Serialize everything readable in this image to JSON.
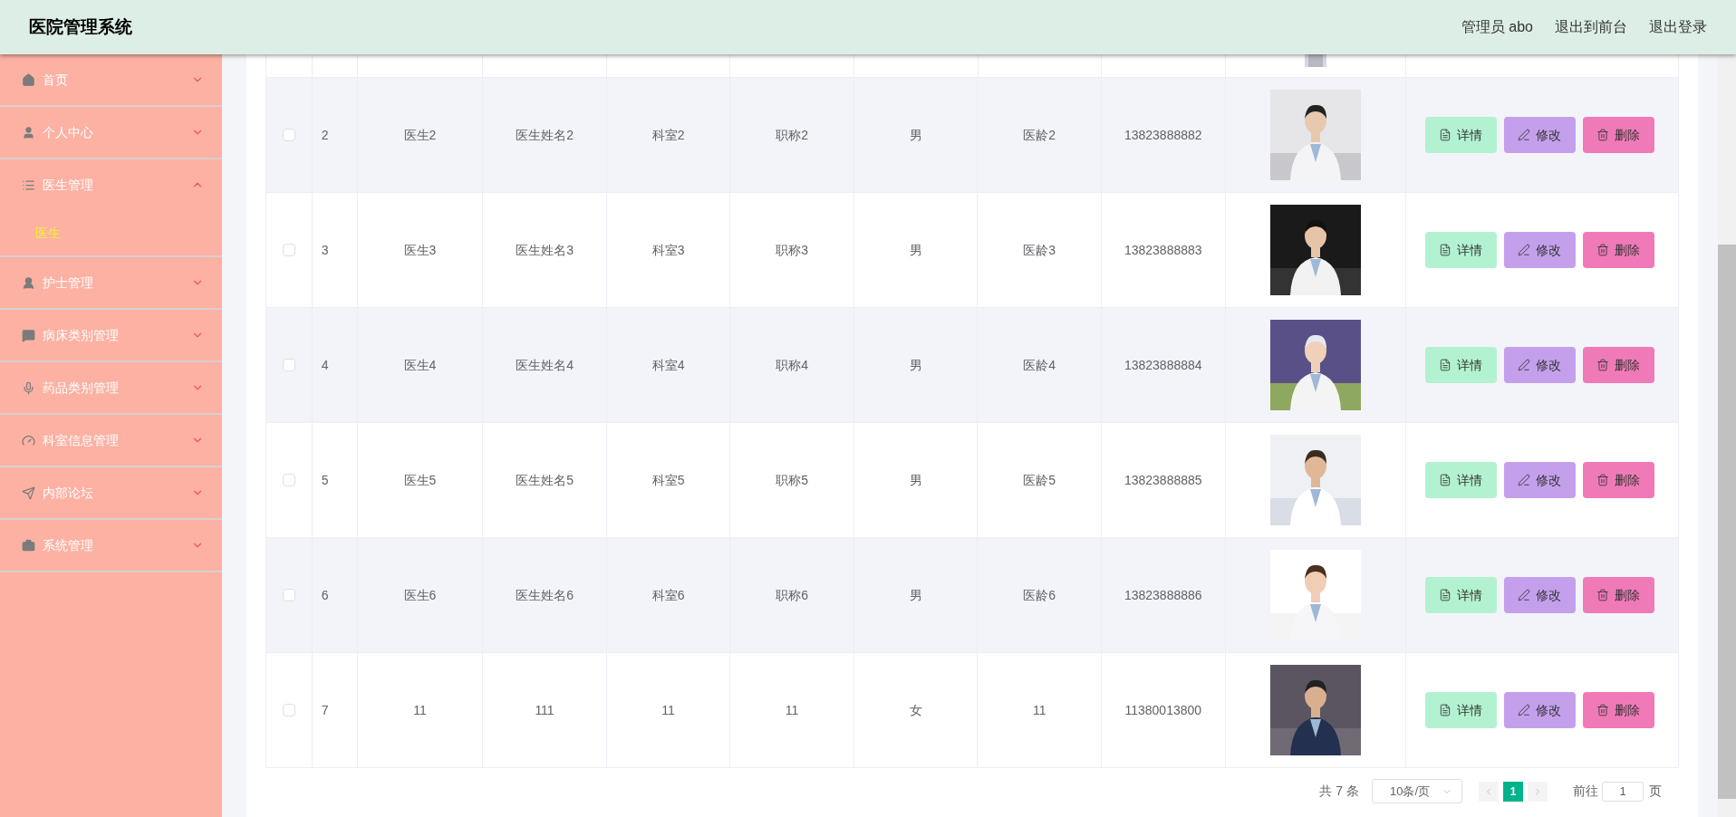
{
  "header": {
    "title": "医院管理系统",
    "links": [
      "管理员 abo",
      "退出到前台",
      "退出登录"
    ]
  },
  "sidebar": {
    "items": [
      {
        "label": "首页",
        "expanded": false
      },
      {
        "label": "个人中心",
        "expanded": false
      },
      {
        "label": "医生管理",
        "expanded": true,
        "children": [
          {
            "label": "医生",
            "selected": true
          }
        ]
      },
      {
        "label": "护士管理",
        "expanded": false
      },
      {
        "label": "病床类别管理",
        "expanded": false
      },
      {
        "label": "药品类别管理",
        "expanded": false
      },
      {
        "label": "科室信息管理",
        "expanded": false
      },
      {
        "label": "内部论坛",
        "expanded": false
      },
      {
        "label": "系统管理",
        "expanded": false
      }
    ]
  },
  "table": {
    "rows": [
      {
        "checked": false,
        "number": "2",
        "cells": [
          "医生2",
          "医生姓名2",
          "科室2",
          "职称2",
          "男",
          "医龄2",
          "13823888882"
        ],
        "actions": [
          {
            "kind": "detail",
            "label": "详情"
          },
          {
            "kind": "edit",
            "label": "修改"
          },
          {
            "kind": "delete",
            "label": "删除"
          }
        ]
      },
      {
        "checked": false,
        "number": "3",
        "cells": [
          "医生3",
          "医生姓名3",
          "科室3",
          "职称3",
          "男",
          "医龄3",
          "13823888883"
        ],
        "actions": [
          {
            "kind": "detail",
            "label": "详情"
          },
          {
            "kind": "edit",
            "label": "修改"
          },
          {
            "kind": "delete",
            "label": "删除"
          }
        ]
      },
      {
        "checked": false,
        "number": "4",
        "cells": [
          "医生4",
          "医生姓名4",
          "科室4",
          "职称4",
          "男",
          "医龄4",
          "13823888884"
        ],
        "actions": [
          {
            "kind": "detail",
            "label": "详情"
          },
          {
            "kind": "edit",
            "label": "修改"
          },
          {
            "kind": "delete",
            "label": "删除"
          }
        ]
      },
      {
        "checked": false,
        "number": "5",
        "cells": [
          "医生5",
          "医生姓名5",
          "科室5",
          "职称5",
          "男",
          "医龄5",
          "13823888885"
        ],
        "actions": [
          {
            "kind": "detail",
            "label": "详情"
          },
          {
            "kind": "edit",
            "label": "修改"
          },
          {
            "kind": "delete",
            "label": "删除"
          }
        ]
      },
      {
        "checked": false,
        "number": "6",
        "cells": [
          "医生6",
          "医生姓名6",
          "科室6",
          "职称6",
          "男",
          "医龄6",
          "13823888886"
        ],
        "actions": [
          {
            "kind": "detail",
            "label": "详情"
          },
          {
            "kind": "edit",
            "label": "修改"
          },
          {
            "kind": "delete",
            "label": "删除"
          }
        ]
      },
      {
        "checked": false,
        "number": "7",
        "cells": [
          "11",
          "111",
          "11",
          "11",
          "女",
          "11",
          "11380013800"
        ],
        "actions": [
          {
            "kind": "detail",
            "label": "详情"
          },
          {
            "kind": "edit",
            "label": "修改"
          },
          {
            "kind": "delete",
            "label": "删除"
          }
        ]
      }
    ]
  },
  "pagination": {
    "total": "共 7 条",
    "page_size": "10条/页",
    "pages": [
      {
        "label": "1",
        "selected": true
      }
    ],
    "goto_label": "前往",
    "goto_value": "1",
    "page_suffix": "页"
  }
}
